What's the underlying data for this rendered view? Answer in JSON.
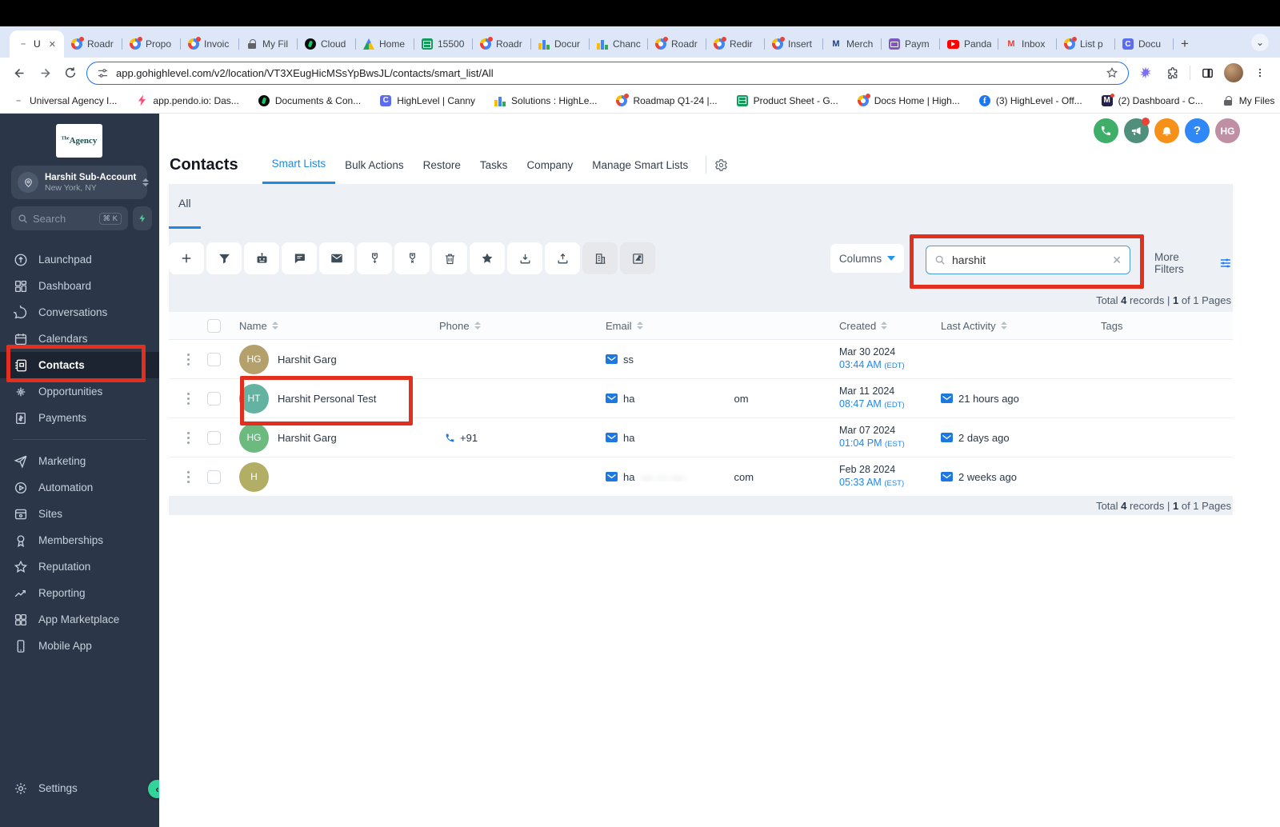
{
  "browser": {
    "active_tab_label": "U",
    "tabs": [
      {
        "label": "Roadr",
        "icon": "canny"
      },
      {
        "label": "Propo",
        "icon": "canny"
      },
      {
        "label": "Invoic",
        "icon": "canny"
      },
      {
        "label": "My Fil",
        "icon": "lock"
      },
      {
        "label": "Cloud",
        "icon": "dark-circle"
      },
      {
        "label": "Home",
        "icon": "drive"
      },
      {
        "label": "15500",
        "icon": "sheets"
      },
      {
        "label": "Roadr",
        "icon": "canny"
      },
      {
        "label": "Docur",
        "icon": "ads"
      },
      {
        "label": "Chanc",
        "icon": "ads"
      },
      {
        "label": "Roadr",
        "icon": "canny"
      },
      {
        "label": "Redir",
        "icon": "canny"
      },
      {
        "label": "Insert",
        "icon": "canny"
      },
      {
        "label": "Merch",
        "icon": "mono-m"
      },
      {
        "label": "Paym",
        "icon": "purple-screen"
      },
      {
        "label": "Panda",
        "icon": "youtube"
      },
      {
        "label": "Inbox",
        "icon": "gmail"
      },
      {
        "label": "List p",
        "icon": "canny"
      },
      {
        "label": "Docu",
        "icon": "canny-blue"
      }
    ],
    "new_tab_label": "+",
    "url": "app.gohighlevel.com/v2/location/VT3XEugHicMSsYpBwsJL/contacts/smart_list/All",
    "bookmarks": [
      {
        "label": "Universal Agency I...",
        "icon": "generic"
      },
      {
        "label": "app.pendo.io: Das...",
        "icon": "pendo"
      },
      {
        "label": "Documents & Con...",
        "icon": "dark-circle"
      },
      {
        "label": "HighLevel | Canny",
        "icon": "canny-blue"
      },
      {
        "label": "Solutions : HighLe...",
        "icon": "ads"
      },
      {
        "label": "Roadmap Q1-24 |...",
        "icon": "canny"
      },
      {
        "label": "Product Sheet - G...",
        "icon": "sheets"
      },
      {
        "label": "Docs Home | High...",
        "icon": "canny"
      },
      {
        "label": "(3) HighLevel - Off...",
        "icon": "facebook"
      },
      {
        "label": "(2) Dashboard - C...",
        "icon": "mdark"
      },
      {
        "label": "My Files",
        "icon": "lock"
      }
    ],
    "bookmarks_overflow": "»"
  },
  "sidebar": {
    "logo_prefix": "The",
    "logo_text": "Agency",
    "account_name": "Harshit Sub-Account",
    "account_location": "New York, NY",
    "search_placeholder": "Search",
    "search_shortcut": "⌘ K",
    "items": [
      {
        "label": "Launchpad"
      },
      {
        "label": "Dashboard"
      },
      {
        "label": "Conversations"
      },
      {
        "label": "Calendars"
      },
      {
        "label": "Contacts",
        "active": true
      },
      {
        "label": "Opportunities"
      },
      {
        "label": "Payments"
      },
      {
        "label": "Marketing"
      },
      {
        "label": "Automation"
      },
      {
        "label": "Sites"
      },
      {
        "label": "Memberships"
      },
      {
        "label": "Reputation"
      },
      {
        "label": "Reporting"
      },
      {
        "label": "App Marketplace"
      },
      {
        "label": "Mobile App"
      }
    ],
    "settings_label": "Settings"
  },
  "header": {
    "title": "Contacts",
    "tabs": [
      {
        "label": "Smart Lists",
        "active": true
      },
      {
        "label": "Bulk Actions"
      },
      {
        "label": "Restore"
      },
      {
        "label": "Tasks"
      },
      {
        "label": "Company"
      },
      {
        "label": "Manage Smart Lists"
      }
    ],
    "subtab": "All",
    "help_glyph": "?",
    "avatar_initials": "HG"
  },
  "controls": {
    "columns_label": "Columns",
    "search_value": "harshit",
    "more_filters_label": "More Filters"
  },
  "summary": {
    "prefix": "Total",
    "count": "4",
    "middle": "records |",
    "page": "1",
    "suffix": "of 1 Pages"
  },
  "table": {
    "columns": [
      "Name",
      "Phone",
      "Email",
      "Created",
      "Last Activity",
      "Tags"
    ],
    "rows": [
      {
        "initials": "HG",
        "name": "Harshit Garg",
        "phone": "",
        "email_start": "ss",
        "email_end": "",
        "created_date": "Mar 30 2024",
        "created_time": "03:44 AM",
        "created_tz": "(EDT)",
        "last_activity": "",
        "avatar_color": "#b3a06b"
      },
      {
        "initials": "HT",
        "name": "Harshit Personal Test",
        "phone": "",
        "email_start": "ha",
        "email_end": "om",
        "created_date": "Mar 11 2024",
        "created_time": "08:47 AM",
        "created_tz": "(EDT)",
        "last_activity": "21 hours ago",
        "avatar_color": "#63b2a2"
      },
      {
        "initials": "HG",
        "name": "Harshit Garg",
        "phone": "+91",
        "email_start": "ha",
        "email_end": "",
        "created_date": "Mar 07 2024",
        "created_time": "01:04 PM",
        "created_tz": "(EST)",
        "last_activity": "2 days ago",
        "avatar_color": "#6cba7f"
      },
      {
        "initials": "H",
        "name": "",
        "phone": "",
        "email_start": "ha",
        "email_end": "com",
        "created_date": "Feb 28 2024",
        "created_time": "05:33 AM",
        "created_tz": "(EST)",
        "last_activity": "2 weeks ago",
        "avatar_color": "#b2ae66"
      }
    ]
  },
  "colors": {
    "accent_blue": "#1e88e5",
    "sidebar_bg": "#2b3648",
    "sidebar_active_bg": "#1b2430",
    "annotation_red": "#e3301e",
    "panel_bg": "#edf1f6",
    "green_collapse": "#34d399"
  }
}
